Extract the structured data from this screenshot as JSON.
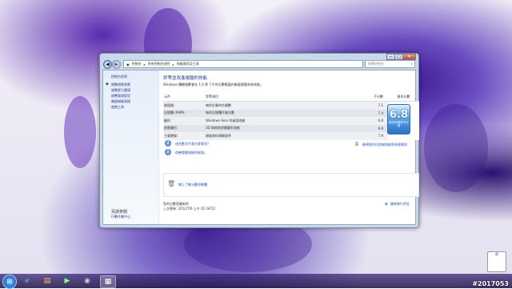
{
  "window": {
    "address": [
      "控制台",
      "所有控制台項目",
      "效能資訊及工具"
    ],
    "search_placeholder": "搜尋控制台",
    "buttons": {
      "minimize": "─",
      "maximize": "□",
      "close": "✕"
    }
  },
  "sidebar": {
    "items": [
      "控制台首頁",
      "調整視覺效果",
      "調整索引選項",
      "調整電源設定",
      "開啟磁碟清理",
      "進階工具"
    ],
    "footer": [
      "另請參閱",
      "行動作業中心"
    ]
  },
  "main": {
    "title": "評等並改進電腦的效能",
    "desc": "Windows 體驗指數會在 1.0 到 7.9 的分數範圍內衡量電腦系統效能。",
    "columns": [
      "元件",
      "評等項目",
      "子分數",
      "基本分數"
    ],
    "rows": [
      {
        "component": "處理器:",
        "item": "每秒計算的作業數",
        "score": "7.1"
      },
      {
        "component": "記憶體 (RAM):",
        "item": "每秒記憶體作業次數",
        "score": "7.4"
      },
      {
        "component": "圖形:",
        "item": "Windows Aero 的桌面效能",
        "score": "6.8"
      },
      {
        "component": "遊戲圖形:",
        "item": "3D 商務和遊戲圖形效能",
        "score": "6.8"
      },
      {
        "component": "主要硬碟:",
        "item": "磁碟資料傳輸速率",
        "score": "7.9"
      }
    ],
    "base_score": "6.8",
    "base_caption": "取決於最低子分數",
    "links": [
      "這些數字代表什麼意思?",
      "改善電腦效能的秘訣。"
    ],
    "online_link": "檢視和列印詳細效能和系統資訊",
    "box_link": "線上了解分數與軟體",
    "status": [
      "您的分數是最新的",
      "上次更新: 2012/7/6 上午 01:18:52"
    ],
    "rerun": "重新執行評定"
  },
  "watermark": "#2017053"
}
